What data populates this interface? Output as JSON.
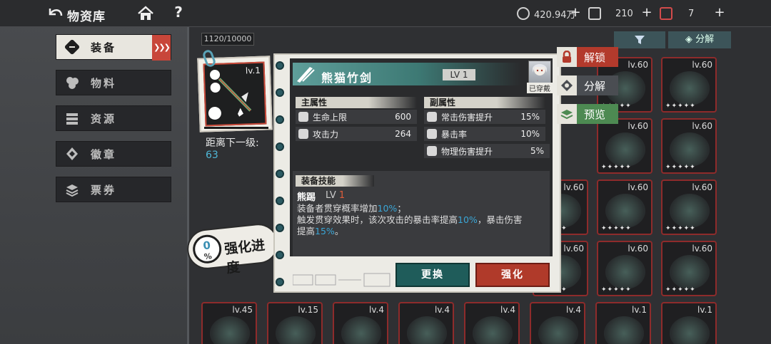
{
  "header": {
    "title": "物资库",
    "currencies": [
      {
        "icon": "coin-icon",
        "value": "420.94万"
      },
      {
        "icon": "gem-icon",
        "value": "210"
      },
      {
        "icon": "ticket-icon",
        "value": "7"
      }
    ]
  },
  "sidebar": {
    "items": [
      {
        "label": "装备",
        "icon": "equipment-icon",
        "active": true
      },
      {
        "label": "物料",
        "icon": "material-icon",
        "active": false
      },
      {
        "label": "资源",
        "icon": "resource-icon",
        "active": false
      },
      {
        "label": "徽章",
        "icon": "badge-icon",
        "active": false
      },
      {
        "label": "票券",
        "icon": "voucher-icon",
        "active": false
      }
    ]
  },
  "inventory": {
    "capacity": "1120/10000",
    "decompose_label": "分解",
    "grid_levels": [
      "lv.60",
      "lv.60",
      "lv.60",
      "lv.60",
      "lv.60",
      "lv.60",
      "lv.60",
      "lv.60",
      "lv.60",
      "lv.60",
      "lv.45",
      "lv.15",
      "lv.4",
      "lv.4",
      "lv.4",
      "lv.4",
      "lv.1",
      "lv.1"
    ]
  },
  "preview": {
    "lv": "lv.1",
    "next_level_label": "距离下一级:",
    "next_level_value": "63",
    "enhance_percent": "0",
    "enhance_percent_unit": "%",
    "enhance_label": "强化进度"
  },
  "item": {
    "name": "熊猫竹剑",
    "level_badge": "LV 1",
    "equipped_label": "已穿戴",
    "main_attr_title": "主属性",
    "sub_attr_title": "副属性",
    "main_attrs": [
      {
        "name": "生命上限",
        "value": "600",
        "icon": "heart-icon"
      },
      {
        "name": "攻击力",
        "value": "264",
        "icon": "crossed-swords-icon"
      }
    ],
    "sub_attrs": [
      {
        "name": "常击伤害提升",
        "value": "15%",
        "icon": "sword-icon"
      },
      {
        "name": "暴击率",
        "value": "10%",
        "icon": "crit-icon"
      },
      {
        "name": "物理伤害提升",
        "value": "5%",
        "icon": "physical-icon"
      }
    ],
    "skill_title": "装备技能",
    "skill_name": "熊踢",
    "skill_lv_prefix": "LV",
    "skill_lv_num": "1",
    "skill_desc": {
      "line1_a": "装备者贯穿概率增加",
      "line1_hl": "10%",
      "line1_b": "；",
      "line2_a": "触发贯穿效果时，该次攻击的暴击率提高",
      "line2_hl": "10%",
      "line2_b": "，暴击伤害",
      "line3_a": "提高",
      "line3_hl": "15%",
      "line3_b": "。"
    },
    "change_button": "更换",
    "enhance_button": "强化"
  },
  "actions": {
    "unlock": "解锁",
    "decompose": "分解",
    "preview": "预览"
  },
  "colors": {
    "teal": "#3d7974",
    "red": "#b03a2a",
    "highlight_blue": "#3aa6d6",
    "level_orange": "#e05d3a"
  }
}
